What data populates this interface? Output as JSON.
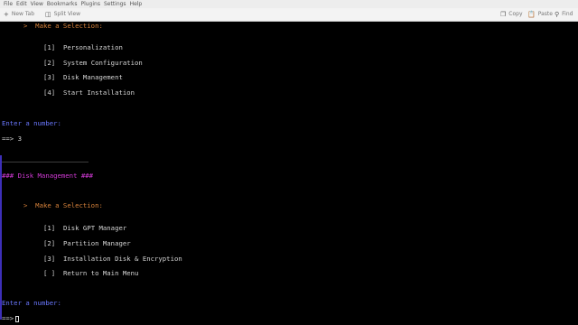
{
  "menu": [
    "File",
    "Edit",
    "View",
    "Bookmarks",
    "Plugins",
    "Settings",
    "Help"
  ],
  "toolbar": {
    "new_tab": "New Tab",
    "split_view": "Split View",
    "copy": "Copy",
    "paste": "Paste",
    "find": "Find"
  },
  "terminal": {
    "prompt1": ">  Make a Selection:",
    "menu1": [
      "[1]  Personalization",
      "[2]  System Configuration",
      "[3]  Disk Management",
      "[4]  Start Installation"
    ],
    "enter1": "Enter a number:",
    "input1": "==> 3",
    "header": "### Disk Management ###",
    "prompt2": ">  Make a Selection:",
    "menu2": [
      "[1]  Disk GPT Manager",
      "[2]  Partition Manager",
      "[3]  Installation Disk & Encryption",
      "[ ]  Return to Main Menu"
    ],
    "enter2": "Enter a number:",
    "input2": "==>"
  },
  "colors": {
    "orange": "#d7823b",
    "blue": "#6a78ff",
    "magenta": "#d23ad6",
    "background": "#000000"
  },
  "icons": [
    "plus-icon",
    "split-view-icon",
    "copy-icon",
    "paste-icon",
    "find-icon"
  ]
}
